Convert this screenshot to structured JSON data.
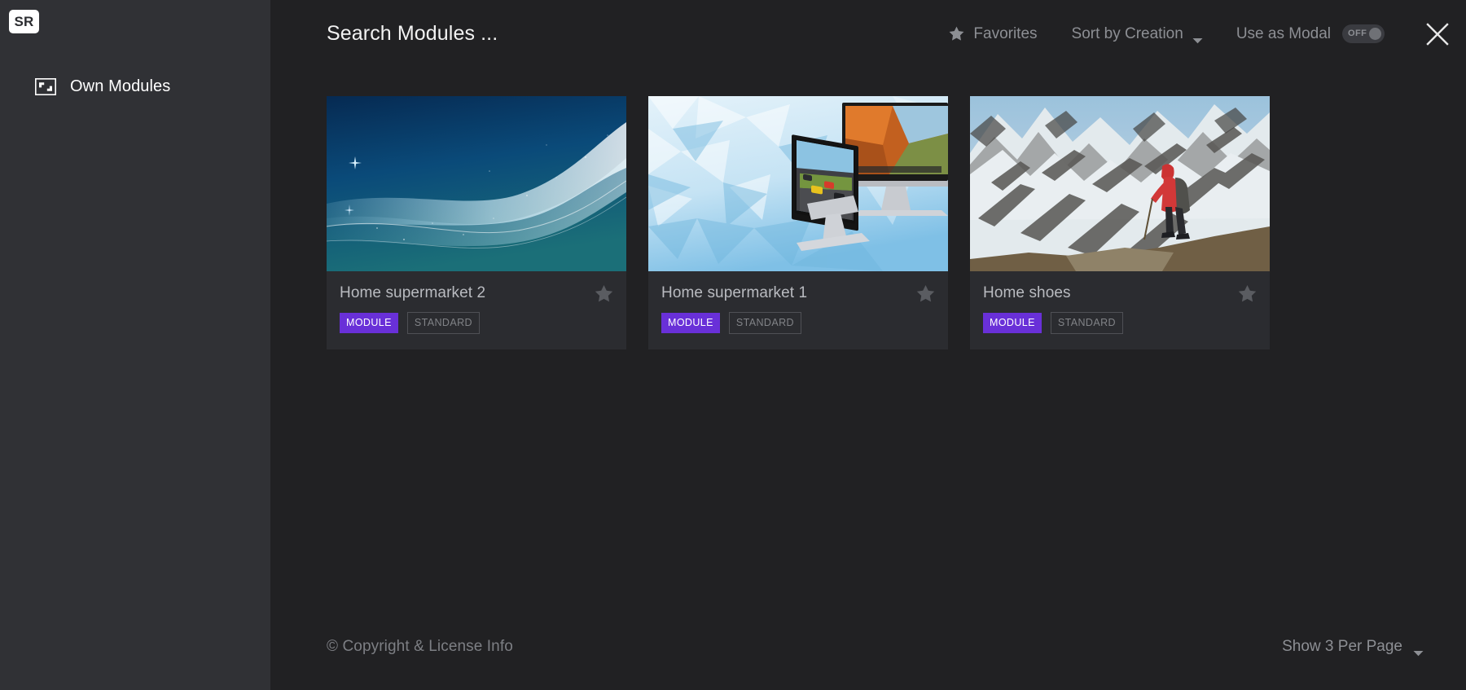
{
  "sidebar": {
    "brand": {
      "text": "SR",
      "name": "brand-logo"
    },
    "items": [
      {
        "label": "Own Modules",
        "icon": "image-frame-icon"
      }
    ]
  },
  "toolbar": {
    "search_placeholder": "Search Modules ...",
    "search_value": "Search Modules ...",
    "favorites_label": "Favorites",
    "favorites_icon": "star-icon",
    "sort_label": "Sort by Creation",
    "sort_icon": "chevron-down-icon",
    "modal_label": "Use as Modal",
    "modal_toggle_state": "OFF",
    "close_icon": "close-icon"
  },
  "cards": [
    {
      "title": "Home supermarket 2",
      "badges": [
        {
          "label": "MODULE",
          "style": "module"
        },
        {
          "label": "STANDARD",
          "style": "standard"
        }
      ],
      "favorite_icon": "star-icon",
      "favorite": false,
      "thumb": "blue-abstract-waves"
    },
    {
      "title": "Home supermarket 1",
      "badges": [
        {
          "label": "MODULE",
          "style": "module"
        },
        {
          "label": "STANDARD",
          "style": "standard"
        }
      ],
      "favorite_icon": "star-icon",
      "favorite": false,
      "thumb": "imac-desktop-displays"
    },
    {
      "title": "Home shoes",
      "badges": [
        {
          "label": "MODULE",
          "style": "module"
        },
        {
          "label": "STANDARD",
          "style": "standard"
        }
      ],
      "favorite_icon": "star-icon",
      "favorite": false,
      "thumb": "snow-mountain-hiker"
    }
  ],
  "footer": {
    "copyright": "© Copyright & License Info",
    "per_page_label": "Show 3 Per Page",
    "per_page_icon": "chevron-down-icon"
  },
  "colors": {
    "accent": "#6930d8",
    "sidebar_bg": "#303135",
    "main_bg": "#212123",
    "card_bg": "#2b2c30",
    "muted_text": "#8d8f94"
  }
}
